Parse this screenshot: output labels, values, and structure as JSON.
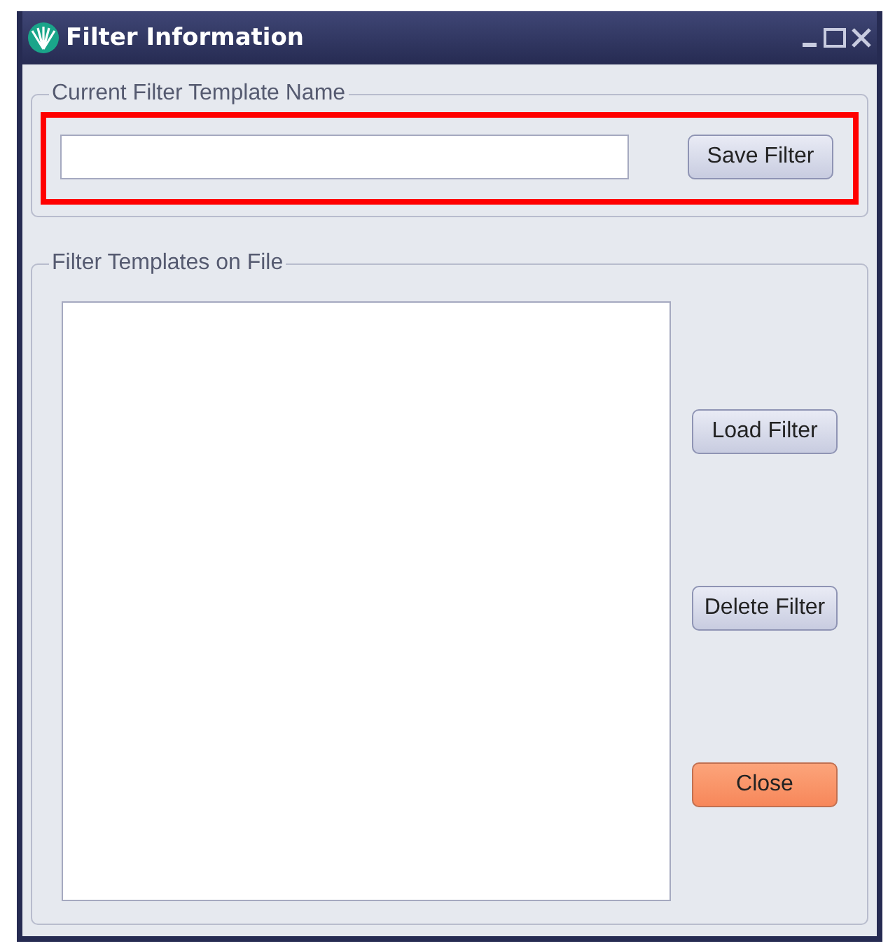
{
  "window": {
    "title": "Filter Information"
  },
  "current_template": {
    "legend": "Current Filter Template Name",
    "highlighted": true,
    "button": {
      "label": "Save Filter"
    }
  },
  "templates_on_file": {
    "legend": "Filter Templates on File",
    "buttons": [
      {
        "label": "Load Filter",
        "kind": "default"
      },
      {
        "label": "Delete Filter",
        "kind": "default"
      },
      {
        "label": "Close",
        "kind": "accent"
      }
    ]
  }
}
